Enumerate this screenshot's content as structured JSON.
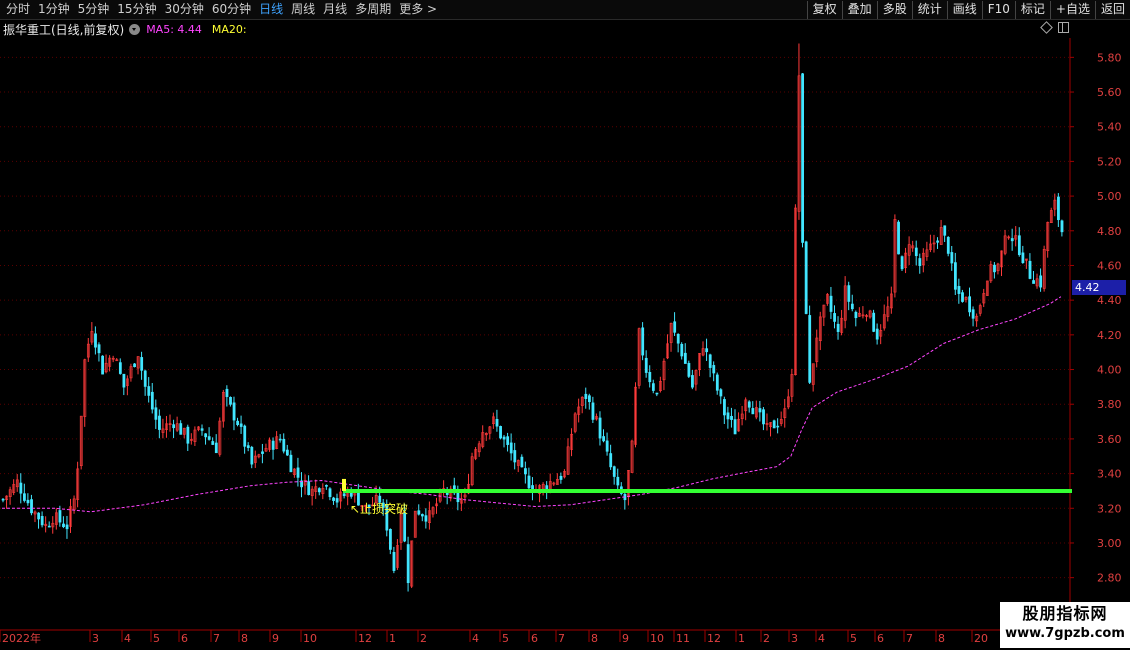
{
  "toolbar": {
    "period_tabs": [
      "分时",
      "1分钟",
      "5分钟",
      "15分钟",
      "30分钟",
      "60分钟",
      "日线",
      "周线",
      "月线",
      "多周期",
      "更多 >"
    ],
    "active_tab": "日线",
    "right_tools": [
      "复权",
      "叠加",
      "多股",
      "统计",
      "画线",
      "F10",
      "标记",
      "+自选",
      "返回"
    ]
  },
  "info_bar": {
    "title": "振华重工(日线,前复权)",
    "ma5_label": "MA5: 4.44",
    "ma20_label": "MA20:"
  },
  "price_tag": "4.42",
  "annotation": "止损突破",
  "x_axis_labels": [
    "2022年",
    "3",
    "4",
    "5",
    "6",
    "7",
    "8",
    "9",
    "10",
    "12",
    "1",
    "2",
    "4",
    "5",
    "6",
    "7",
    "8",
    "9",
    "10",
    "11",
    "12",
    "1",
    "2",
    "3",
    "4",
    "5",
    "6",
    "7",
    "8",
    "20"
  ],
  "watermark": {
    "title": "股朋指标网",
    "url": "www.7gpzb.com"
  },
  "colors": {
    "up": "#ff3b3b",
    "down": "#42e6ff",
    "support_line": "#33ff33",
    "ma_line": "#ff44ff",
    "grid": "#5a0000",
    "axis_text": "#e04040",
    "active_tab": "#3ea3ff"
  },
  "chart_data": {
    "type": "candlestick",
    "y_ticks": [
      2.8,
      3.0,
      3.2,
      3.4,
      3.6,
      3.8,
      4.0,
      4.2,
      4.4,
      4.6,
      4.8,
      5.0,
      5.2,
      5.4,
      5.6,
      5.8
    ],
    "ylim": [
      2.7,
      5.9
    ],
    "support_level": 3.3,
    "last_price": 4.42,
    "close_path": [
      [
        0,
        3.25
      ],
      [
        4,
        3.35
      ],
      [
        8,
        3.2
      ],
      [
        12,
        3.1
      ],
      [
        14,
        3.15
      ],
      [
        18,
        3.1
      ],
      [
        20,
        3.25
      ],
      [
        21,
        3.45
      ],
      [
        23,
        4.05
      ],
      [
        25,
        4.25
      ],
      [
        28,
        4.0
      ],
      [
        31,
        4.1
      ],
      [
        34,
        3.9
      ],
      [
        38,
        4.1
      ],
      [
        40,
        3.9
      ],
      [
        44,
        3.65
      ],
      [
        48,
        3.7
      ],
      [
        52,
        3.6
      ],
      [
        56,
        3.65
      ],
      [
        60,
        3.55
      ],
      [
        62,
        3.85
      ],
      [
        66,
        3.7
      ],
      [
        70,
        3.45
      ],
      [
        74,
        3.55
      ],
      [
        78,
        3.6
      ],
      [
        81,
        3.45
      ],
      [
        84,
        3.35
      ],
      [
        87,
        3.3
      ],
      [
        90,
        3.35
      ],
      [
        94,
        3.25
      ],
      [
        98,
        3.3
      ],
      [
        102,
        3.2
      ],
      [
        106,
        3.25
      ],
      [
        108,
        3.1
      ],
      [
        110,
        2.85
      ],
      [
        112,
        3.2
      ],
      [
        114,
        2.8
      ],
      [
        116,
        3.2
      ],
      [
        120,
        3.15
      ],
      [
        124,
        3.3
      ],
      [
        128,
        3.25
      ],
      [
        130,
        3.25
      ],
      [
        132,
        3.5
      ],
      [
        135,
        3.65
      ],
      [
        138,
        3.7
      ],
      [
        142,
        3.55
      ],
      [
        146,
        3.4
      ],
      [
        150,
        3.3
      ],
      [
        154,
        3.35
      ],
      [
        158,
        3.4
      ],
      [
        161,
        3.75
      ],
      [
        164,
        3.85
      ],
      [
        167,
        3.7
      ],
      [
        170,
        3.5
      ],
      [
        173,
        3.3
      ],
      [
        175,
        3.25
      ],
      [
        177,
        3.55
      ],
      [
        179,
        4.2
      ],
      [
        181,
        4.0
      ],
      [
        184,
        3.85
      ],
      [
        188,
        4.25
      ],
      [
        191,
        4.1
      ],
      [
        194,
        3.9
      ],
      [
        197,
        4.15
      ],
      [
        200,
        3.95
      ],
      [
        203,
        3.75
      ],
      [
        206,
        3.65
      ],
      [
        209,
        3.85
      ],
      [
        212,
        3.75
      ],
      [
        215,
        3.65
      ],
      [
        218,
        3.7
      ],
      [
        220,
        3.75
      ],
      [
        222,
        4.0
      ],
      [
        223,
        4.9
      ],
      [
        224,
        5.7
      ],
      [
        225,
        4.7
      ],
      [
        226,
        4.35
      ],
      [
        227,
        3.9
      ],
      [
        229,
        4.2
      ],
      [
        232,
        4.4
      ],
      [
        235,
        4.2
      ],
      [
        237,
        4.45
      ],
      [
        240,
        4.3
      ],
      [
        243,
        4.35
      ],
      [
        246,
        4.2
      ],
      [
        248,
        4.3
      ],
      [
        250,
        4.4
      ],
      [
        251,
        4.85
      ],
      [
        253,
        4.55
      ],
      [
        255,
        4.75
      ],
      [
        258,
        4.6
      ],
      [
        261,
        4.7
      ],
      [
        264,
        4.8
      ],
      [
        266,
        4.7
      ],
      [
        268,
        4.45
      ],
      [
        271,
        4.4
      ],
      [
        274,
        4.3
      ],
      [
        277,
        4.55
      ],
      [
        280,
        4.6
      ],
      [
        283,
        4.8
      ],
      [
        286,
        4.7
      ],
      [
        289,
        4.55
      ],
      [
        292,
        4.5
      ],
      [
        294,
        4.85
      ],
      [
        296,
        4.95
      ],
      [
        298,
        4.8
      ]
    ],
    "ma_line": [
      [
        0,
        3.2
      ],
      [
        15,
        3.2
      ],
      [
        25,
        3.18
      ],
      [
        40,
        3.22
      ],
      [
        55,
        3.28
      ],
      [
        70,
        3.33
      ],
      [
        80,
        3.35
      ],
      [
        90,
        3.36
      ],
      [
        100,
        3.33
      ],
      [
        110,
        3.3
      ],
      [
        120,
        3.28
      ],
      [
        130,
        3.25
      ],
      [
        140,
        3.23
      ],
      [
        150,
        3.21
      ],
      [
        160,
        3.22
      ],
      [
        170,
        3.25
      ],
      [
        180,
        3.28
      ],
      [
        190,
        3.32
      ],
      [
        200,
        3.37
      ],
      [
        210,
        3.41
      ],
      [
        218,
        3.44
      ],
      [
        222,
        3.5
      ],
      [
        225,
        3.65
      ],
      [
        228,
        3.78
      ],
      [
        235,
        3.87
      ],
      [
        245,
        3.94
      ],
      [
        255,
        4.02
      ],
      [
        265,
        4.15
      ],
      [
        275,
        4.23
      ],
      [
        285,
        4.29
      ],
      [
        295,
        4.38
      ],
      [
        298,
        4.42
      ]
    ]
  }
}
